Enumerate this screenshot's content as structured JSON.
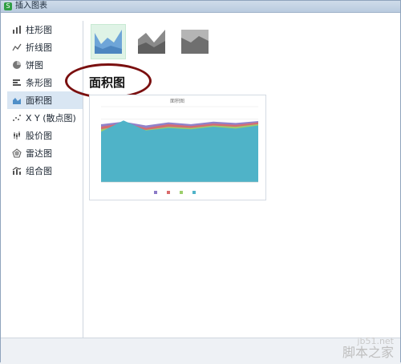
{
  "window": {
    "title": "插入图表"
  },
  "sidebar": {
    "items": [
      {
        "label": "柱形图",
        "icon": "column-chart-icon"
      },
      {
        "label": "折线图",
        "icon": "line-chart-icon"
      },
      {
        "label": "饼图",
        "icon": "pie-chart-icon"
      },
      {
        "label": "条形图",
        "icon": "bar-chart-icon"
      },
      {
        "label": "面积图",
        "icon": "area-chart-icon",
        "selected": true
      },
      {
        "label": "X Y (散点图)",
        "icon": "scatter-chart-icon"
      },
      {
        "label": "股价图",
        "icon": "stock-chart-icon"
      },
      {
        "label": "雷达图",
        "icon": "radar-chart-icon"
      },
      {
        "label": "组合图",
        "icon": "combo-chart-icon"
      }
    ]
  },
  "content": {
    "heading": "面积图",
    "thumbnails": [
      {
        "name": "area",
        "selected": true
      },
      {
        "name": "stacked-area",
        "selected": false
      },
      {
        "name": "percent-stacked-area",
        "selected": false
      }
    ]
  },
  "watermark": {
    "line1": "jb51.net",
    "line2": "脚本之家"
  },
  "colors": {
    "accent": "#2f9e44",
    "selection": "#d9e6f3",
    "annotation": "#7a0f0f"
  },
  "chart_data": {
    "type": "area",
    "title": "面积图",
    "categories": [
      "",
      "",
      "",
      "",
      "",
      "",
      "",
      ""
    ],
    "series": [
      {
        "values": [
          92,
          96,
          90,
          95,
          92,
          96,
          94,
          97
        ]
      },
      {
        "values": [
          88,
          94,
          86,
          92,
          89,
          93,
          91,
          95
        ]
      },
      {
        "values": [
          84,
          90,
          83,
          88,
          86,
          90,
          88,
          92
        ]
      },
      {
        "values": [
          80,
          98,
          82,
          86,
          84,
          88,
          85,
          90
        ]
      }
    ],
    "ylim": [
      0,
      120
    ],
    "grid": true,
    "legend": "bottom",
    "colors": [
      "#8b7ac7",
      "#d96b6b",
      "#9ccf6b",
      "#4fb3c8"
    ]
  }
}
